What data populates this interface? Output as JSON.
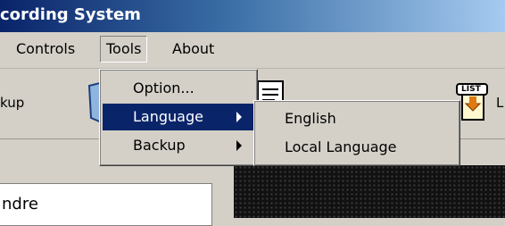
{
  "window": {
    "title": "cording System"
  },
  "menubar": {
    "items": [
      "Controls",
      "Tools",
      "About"
    ]
  },
  "toolbar": {
    "labels": [
      "kup",
      "L"
    ],
    "list_icon_text": "LIST"
  },
  "tools_menu": {
    "items": [
      {
        "label": "Option...",
        "has_submenu": false
      },
      {
        "label": "Language",
        "has_submenu": true,
        "selected": true
      },
      {
        "label": "Backup",
        "has_submenu": true
      }
    ]
  },
  "language_submenu": {
    "items": [
      "English",
      "Local Language"
    ]
  },
  "panel": {
    "name_text": "ndre"
  },
  "colors": {
    "title_start": "#0a246a",
    "selection": "#0a246a",
    "face": "#d4d0c8"
  }
}
